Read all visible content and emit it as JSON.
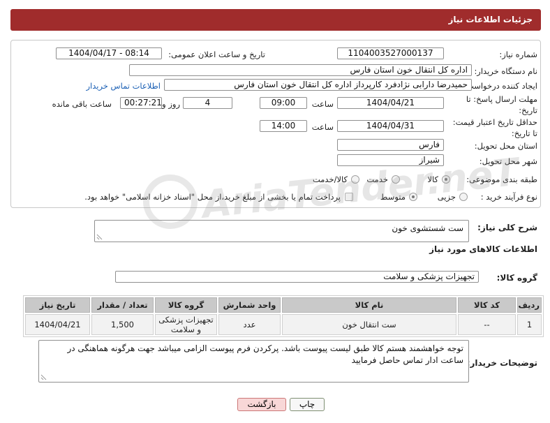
{
  "header": {
    "title": "جزئیات اطلاعات نیاز"
  },
  "need_number": {
    "label": "شماره نیاز:",
    "value": "1104003527000137"
  },
  "announce": {
    "label": "تاریخ و ساعت اعلان عمومی:",
    "value": "1404/04/17 - 08:14"
  },
  "buyer_org": {
    "label": "نام دستگاه خریدار:",
    "value": "اداره کل انتقال خون استان فارس"
  },
  "requester": {
    "label": "ایجاد کننده درخواست:",
    "value": "حمیدرضا دارابی نژادفرد کارپرداز اداره کل انتقال خون استان فارس",
    "contact_link": "اطلاعات تماس خریدار"
  },
  "response_deadline": {
    "label_line1": "مهلت ارسال پاسخ: تا",
    "label_line2": "تاریخ:",
    "date": "1404/04/21",
    "time_label": "ساعت",
    "time": "09:00",
    "days": "4",
    "days_label": "روز و",
    "remaining": "00:27:21",
    "remaining_label": "ساعت باقی مانده"
  },
  "price_validity": {
    "label_line1": "حداقل تاریخ اعتبار قیمت:",
    "label_line2": "تا تاریخ:",
    "date": "1404/04/31",
    "time_label": "ساعت",
    "time": "14:00"
  },
  "delivery_province": {
    "label": "استان محل تحویل:",
    "value": "فارس"
  },
  "delivery_city": {
    "label": "شهر محل تحویل:",
    "value": "شیراز"
  },
  "subject_category": {
    "label": "طبقه بندی موضوعی:",
    "options": [
      {
        "label": "کالا",
        "selected": true
      },
      {
        "label": "خدمت",
        "selected": false
      },
      {
        "label": "کالا/خدمت",
        "selected": false
      }
    ]
  },
  "purchase_process": {
    "label": "نوع فرآیند خرید :",
    "options": [
      {
        "label": "جزیی",
        "selected": false
      },
      {
        "label": "متوسط",
        "selected": true
      }
    ],
    "treasury_checkbox": {
      "label": "پرداخت تمام یا بخشی از مبلغ خرید،از محل \"اسناد خزانه اسلامی\" خواهد بود.",
      "checked": false
    }
  },
  "description": {
    "label": "شرح کلی نیاز:",
    "value": "ست شستشوی خون"
  },
  "goods": {
    "title": "اطلاعات کالاهای مورد نیاز",
    "group_label": "گروه کالا:",
    "group_value": "تجهیزات پزشکی و سلامت"
  },
  "table": {
    "columns": [
      "ردیف",
      "کد کالا",
      "نام کالا",
      "واحد شمارش",
      "گروه کالا",
      "تعداد / مقدار",
      "تاریخ نیاز"
    ],
    "rows": [
      [
        "1",
        "--",
        "ست انتقال خون",
        "عدد",
        "تجهیزات پزشکی و سلامت",
        "1,500",
        "1404/04/21"
      ]
    ]
  },
  "buyer_notes": {
    "label": "توضیحات خریدار:",
    "value": "توجه خواهشمند هستم کالا طبق لیست پیوست باشد. پرکردن فرم پیوست الزامی میباشد جهت هرگونه هماهنگی در ساعت ادار تماس حاصل فرمایید"
  },
  "buttons": {
    "print": "چاپ",
    "back": "بازگشت"
  },
  "watermark": {
    "text": "AriaTender.neT"
  },
  "colors": {
    "header_bg": "#a02c2c",
    "link": "#1a5fb4",
    "back_button_bg": "#f8d7d7",
    "print_button_bg": "#f7f7f7",
    "table_header_bg": "#c9c9c9"
  }
}
